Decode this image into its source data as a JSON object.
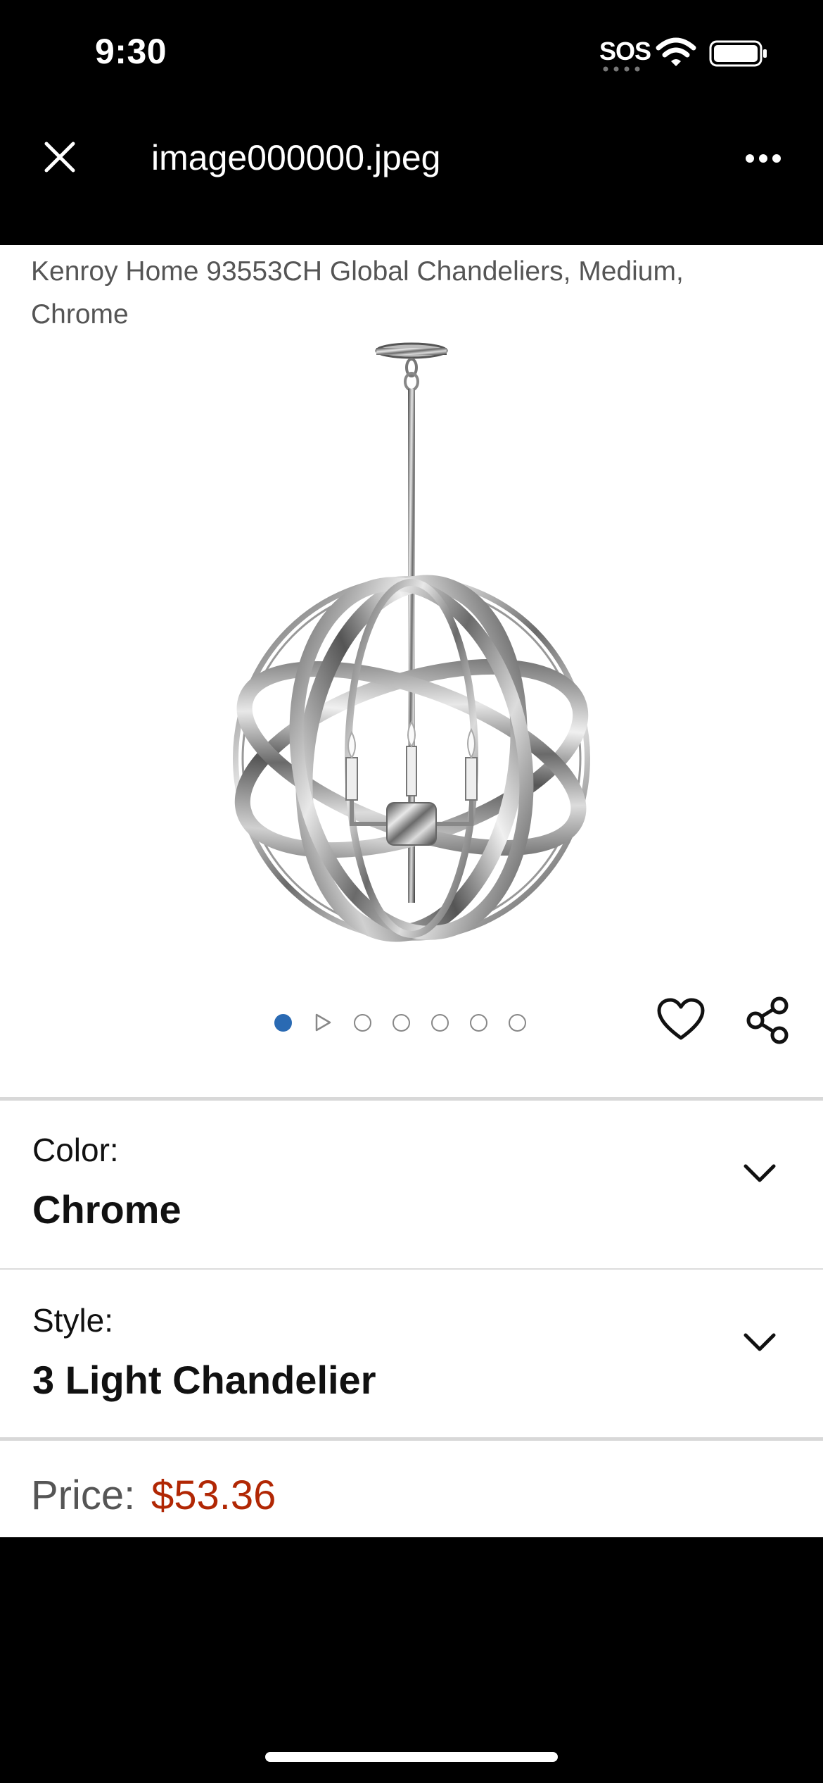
{
  "status_bar": {
    "time": "9:30",
    "sos": "SOS",
    "icons": [
      "wifi-icon",
      "battery-icon"
    ]
  },
  "viewer": {
    "file_name": "image000000.jpeg",
    "icons": [
      "close-icon",
      "more-icon"
    ]
  },
  "product": {
    "title": "Kenroy Home 93553CH Global Chandeliers, Medium, Chrome",
    "image_icon": "chandelier-image",
    "carousel": {
      "total": 7,
      "active_index": 0,
      "has_video_slide": true
    }
  },
  "options": {
    "color": {
      "label": "Color:",
      "value": "Chrome"
    },
    "style": {
      "label": "Style:",
      "value": "3 Light Chandelier"
    }
  },
  "price": {
    "label": "Price:",
    "value": "$53.36",
    "color": "#b12704"
  },
  "accent_color": "#2a6ab3"
}
